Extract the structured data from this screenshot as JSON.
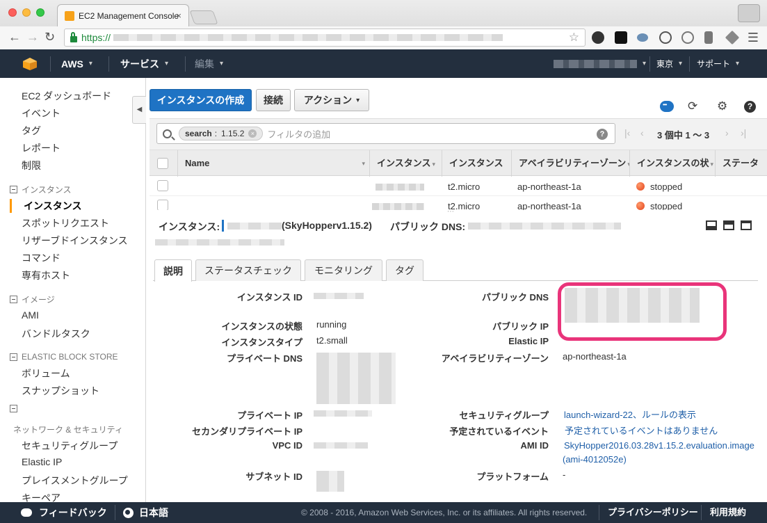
{
  "browser": {
    "tab_title": "EC2 Management Console",
    "url_scheme": "https://"
  },
  "awsnav": {
    "brand": "AWS",
    "services": "サービス",
    "edit": "編集",
    "region": "東京",
    "support": "サポート"
  },
  "sidebar": {
    "dashboard": "EC2 ダッシュボード",
    "events": "イベント",
    "tags": "タグ",
    "reports": "レポート",
    "limits": "制限",
    "section_instances": "インスタンス",
    "instances": "インスタンス",
    "spot_requests": "スポットリクエスト",
    "reserved": "リザーブドインスタンス",
    "commands": "コマンド",
    "dedicated_hosts": "専有ホスト",
    "section_images": "イメージ",
    "ami": "AMI",
    "bundle_tasks": "バンドルタスク",
    "section_ebs": "ELASTIC BLOCK STORE",
    "volumes": "ボリューム",
    "snapshots": "スナップショット",
    "section_network": "ネットワーク & セキュリティ",
    "security_groups": "セキュリティグループ",
    "elastic_ip": "Elastic IP",
    "placement_groups": "プレイスメントグループ",
    "key_pairs_partial": "キーペア"
  },
  "toolbar": {
    "create_instance": "インスタンスの作成",
    "connect": "接続",
    "actions": "アクション"
  },
  "filter": {
    "token_key": "search",
    "token_sep": ":",
    "token_value": "1.15.2",
    "placeholder": "フィルタの追加",
    "pager_text": "3 個中 1 〜 3"
  },
  "table": {
    "headers": [
      "Name",
      "インスタンス",
      "インスタンス",
      "アベイラビリティーゾーン",
      "インスタンスの状",
      "ステータ"
    ],
    "rows": [
      {
        "type": "t2.micro",
        "zone": "ap-northeast-1a",
        "state": "stopped"
      },
      {
        "type": "t2.micro",
        "zone": "ap-northeast-1a",
        "state": "stopped"
      }
    ]
  },
  "detail": {
    "instance_label": "インスタンス:",
    "instance_name": "(SkyHopperv1.15.2)",
    "public_dns_label": "パブリック DNS:",
    "tabs": [
      "説明",
      "ステータスチェック",
      "モニタリング",
      "タグ"
    ],
    "left": {
      "instance_id": "インスタンス ID",
      "state": "インスタンスの状態",
      "state_value": "running",
      "type": "インスタンスタイプ",
      "type_value": "t2.small",
      "private_dns": "プライベート DNS",
      "private_ip": "プライベート IP",
      "secondary_ip": "セカンダリプライベート IP",
      "vpc_id": "VPC ID",
      "subnet_id": "サブネット ID"
    },
    "right": {
      "public_dns": "パブリック DNS",
      "public_ip": "パブリック IP",
      "elastic_ip": "Elastic IP",
      "az": "アベイラビリティーゾーン",
      "az_value": "ap-northeast-1a",
      "security_groups": "セキュリティグループ",
      "sg_value": "launch-wizard-22",
      "sg_rules": "ルールの表示",
      "scheduled_events": "予定されているイベント",
      "scheduled_events_value": "予定されているイベントはありません",
      "ami_id": "AMI ID",
      "ami_value": "SkyHopper2016.03.28v1.15.2.evaluation.image",
      "ami_value_id": "(ami-4012052e)",
      "platform": "プラットフォーム",
      "platform_value": "-"
    }
  },
  "footer": {
    "feedback": "フィードバック",
    "language": "日本語",
    "copyright": "© 2008 - 2016, Amazon Web Services, Inc. or its affiliates. All rights reserved.",
    "privacy": "プライバシーポリシー",
    "terms": "利用規約"
  },
  "colors": {
    "aws_nav": "#232f3e",
    "primary": "#1f73c4",
    "highlight": "#e9347a",
    "stopped": "#e2411a",
    "aws_orange": "#f90"
  }
}
